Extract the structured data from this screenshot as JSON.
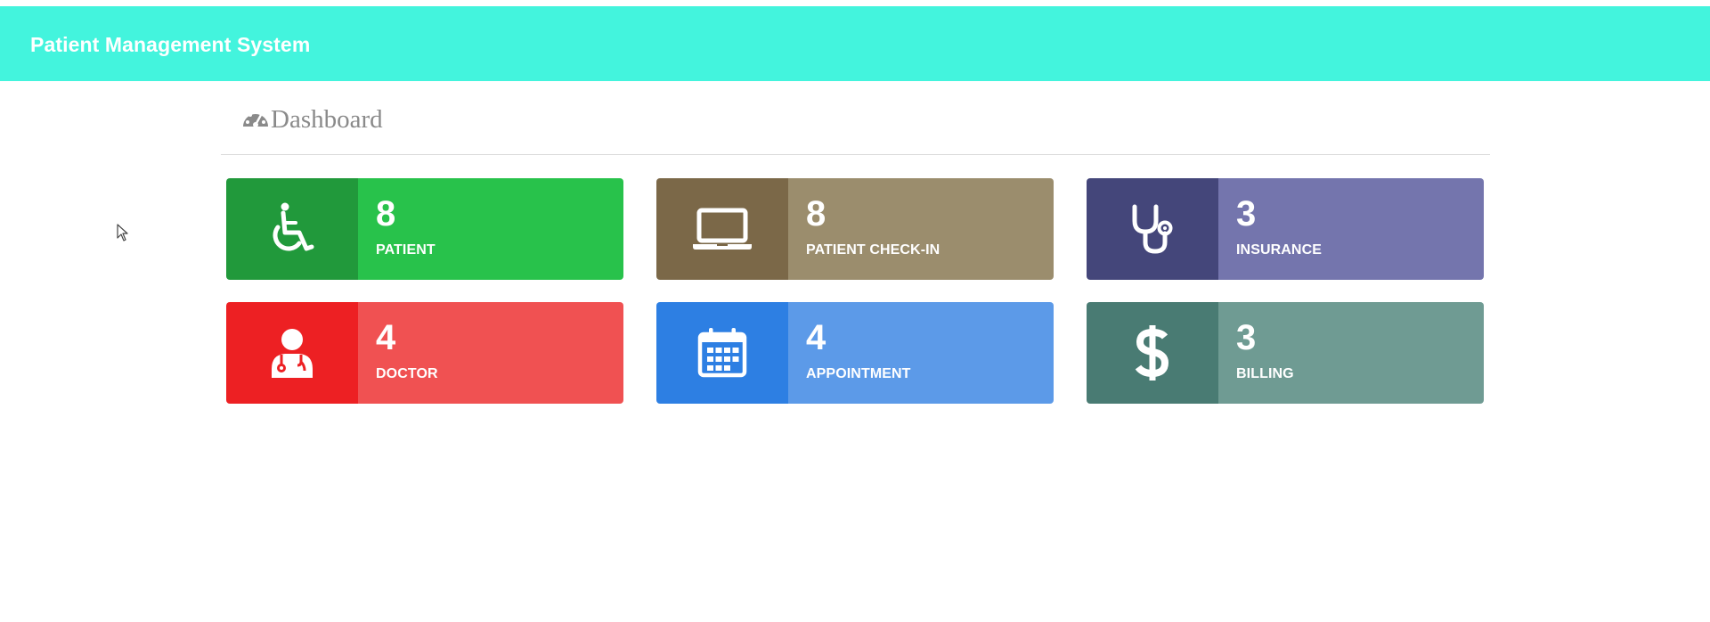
{
  "app": {
    "title": "Patient Management System",
    "header_color": "#43f4dd"
  },
  "page": {
    "title": "Dashboard",
    "title_icon": "dashboard-gauge-icon"
  },
  "tiles": [
    {
      "id": "patient",
      "value": "8",
      "label": "PATIENT",
      "icon": "wheelchair-icon",
      "icon_bg": "#21993b",
      "body_bg": "#28c24b"
    },
    {
      "id": "patient-check-in",
      "value": "8",
      "label": "PATIENT CHECK-IN",
      "icon": "laptop-icon",
      "icon_bg": "#7b6848",
      "body_bg": "#9b8d6d"
    },
    {
      "id": "insurance",
      "value": "3",
      "label": "INSURANCE",
      "icon": "stethoscope-icon",
      "icon_bg": "#44467a",
      "body_bg": "#7475ad"
    },
    {
      "id": "doctor",
      "value": "4",
      "label": "DOCTOR",
      "icon": "user-doctor-icon",
      "icon_bg": "#ed2023",
      "body_bg": "#f05152"
    },
    {
      "id": "appointment",
      "value": "4",
      "label": "APPOINTMENT",
      "icon": "calendar-icon",
      "icon_bg": "#2d7fe3",
      "body_bg": "#5c9ae8"
    },
    {
      "id": "billing",
      "value": "3",
      "label": "BILLING",
      "icon": "dollar-icon",
      "icon_bg": "#497b73",
      "body_bg": "#6f9b93"
    }
  ]
}
